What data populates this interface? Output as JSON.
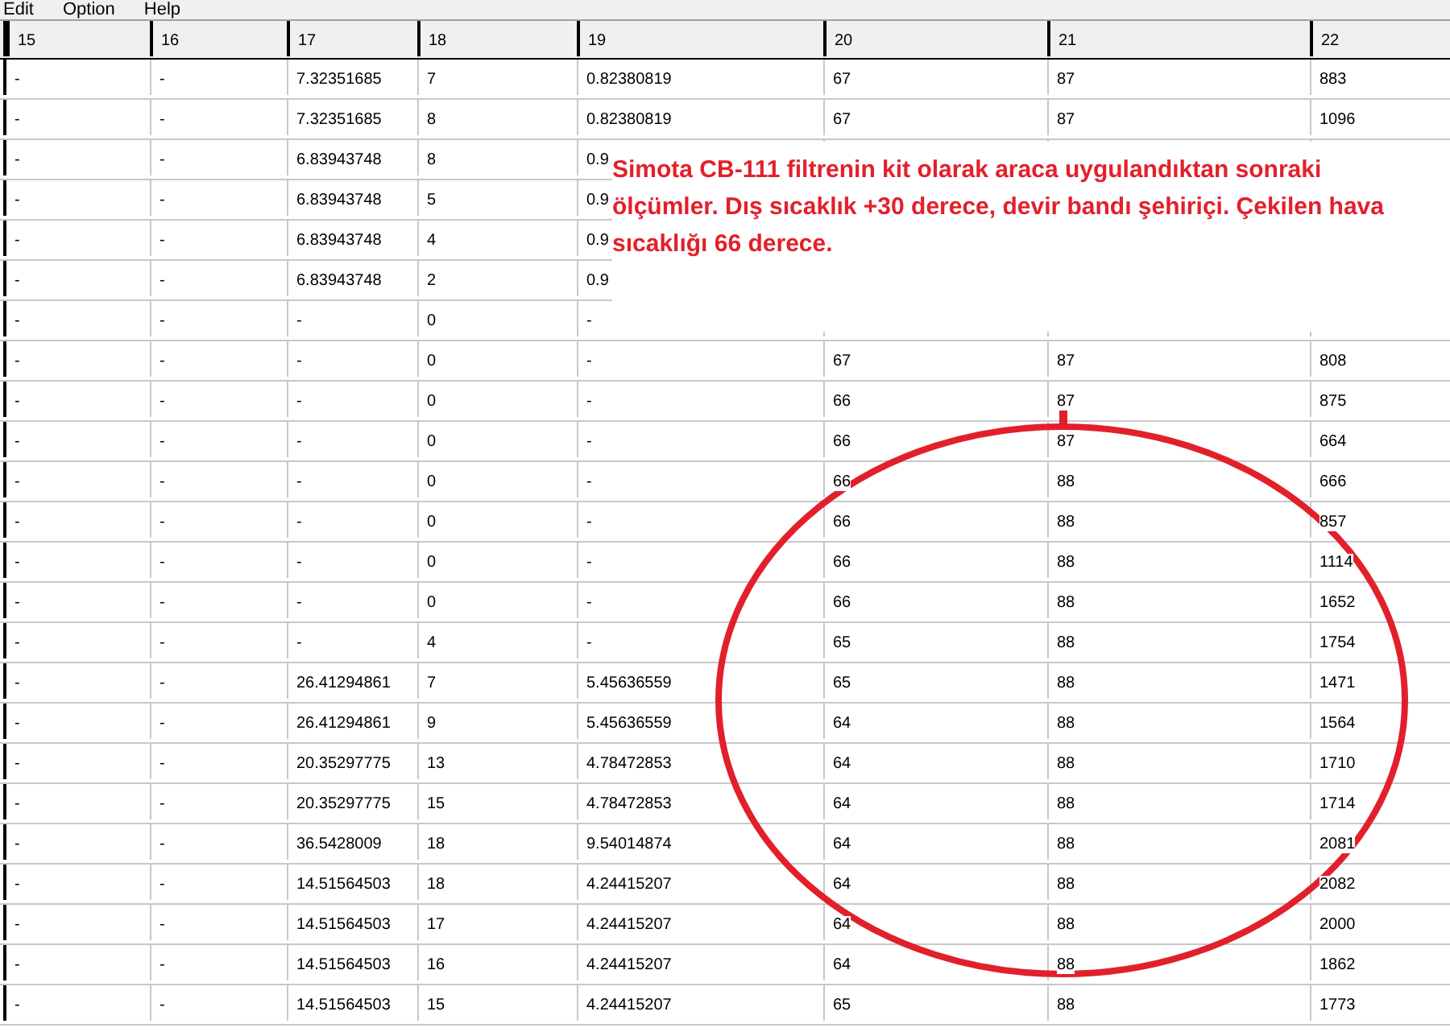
{
  "menu": [
    "Edit",
    "Option",
    "Help"
  ],
  "table": {
    "columns": [
      "15",
      "16",
      "17",
      "18",
      "19",
      "20",
      "21",
      "22"
    ],
    "rows": [
      [
        "-",
        "-",
        "7.32351685",
        "7",
        "0.82380819",
        "67",
        "87",
        "883"
      ],
      [
        "-",
        "-",
        "7.32351685",
        "8",
        "0.82380819",
        "67",
        "87",
        "1096"
      ],
      [
        "-",
        "-",
        "6.83943748",
        "8",
        "0.9",
        null,
        null,
        null
      ],
      [
        "-",
        "-",
        "6.83943748",
        "5",
        "0.9",
        null,
        null,
        null
      ],
      [
        "-",
        "-",
        "6.83943748",
        "4",
        "0.9",
        null,
        null,
        null
      ],
      [
        "-",
        "-",
        "6.83943748",
        "2",
        "0.9",
        null,
        null,
        null
      ],
      [
        "-",
        "-",
        "-",
        "0",
        "-",
        null,
        null,
        null
      ],
      [
        "-",
        "-",
        "-",
        "0",
        "-",
        "67",
        "87",
        "808"
      ],
      [
        "-",
        "-",
        "-",
        "0",
        "-",
        "66",
        "87",
        "875"
      ],
      [
        "-",
        "-",
        "-",
        "0",
        "-",
        "66",
        "87",
        "664"
      ],
      [
        "-",
        "-",
        "-",
        "0",
        "-",
        "66",
        "88",
        "666"
      ],
      [
        "-",
        "-",
        "-",
        "0",
        "-",
        "66",
        "88",
        "857"
      ],
      [
        "-",
        "-",
        "-",
        "0",
        "-",
        "66",
        "88",
        "1114"
      ],
      [
        "-",
        "-",
        "-",
        "0",
        "-",
        "66",
        "88",
        "1652"
      ],
      [
        "-",
        "-",
        "-",
        "4",
        "-",
        "65",
        "88",
        "1754"
      ],
      [
        "-",
        "-",
        "26.41294861",
        "7",
        "5.45636559",
        "65",
        "88",
        "1471"
      ],
      [
        "-",
        "-",
        "26.41294861",
        "9",
        "5.45636559",
        "64",
        "88",
        "1564"
      ],
      [
        "-",
        "-",
        "20.35297775",
        "13",
        "4.78472853",
        "64",
        "88",
        "1710"
      ],
      [
        "-",
        "-",
        "20.35297775",
        "15",
        "4.78472853",
        "64",
        "88",
        "1714"
      ],
      [
        "-",
        "-",
        "36.5428009",
        "18",
        "9.54014874",
        "64",
        "88",
        "2081"
      ],
      [
        "-",
        "-",
        "14.51564503",
        "18",
        "4.24415207",
        "64",
        "88",
        "2082"
      ],
      [
        "-",
        "-",
        "14.51564503",
        "17",
        "4.24415207",
        "64",
        "88",
        "2000"
      ],
      [
        "-",
        "-",
        "14.51564503",
        "16",
        "4.24415207",
        "64",
        "88",
        "1862"
      ],
      [
        "-",
        "-",
        "14.51564503",
        "15",
        "4.24415207",
        "65",
        "88",
        "1773"
      ]
    ]
  },
  "annotation": {
    "text": "Simota CB-111 filtrenin kit olarak araca uygulandıktan sonraki ölçümler. Dış sıcaklık +30 derece, devir bandı şehiriçi. Çekilen hava sıcaklığı 66 derece."
  }
}
